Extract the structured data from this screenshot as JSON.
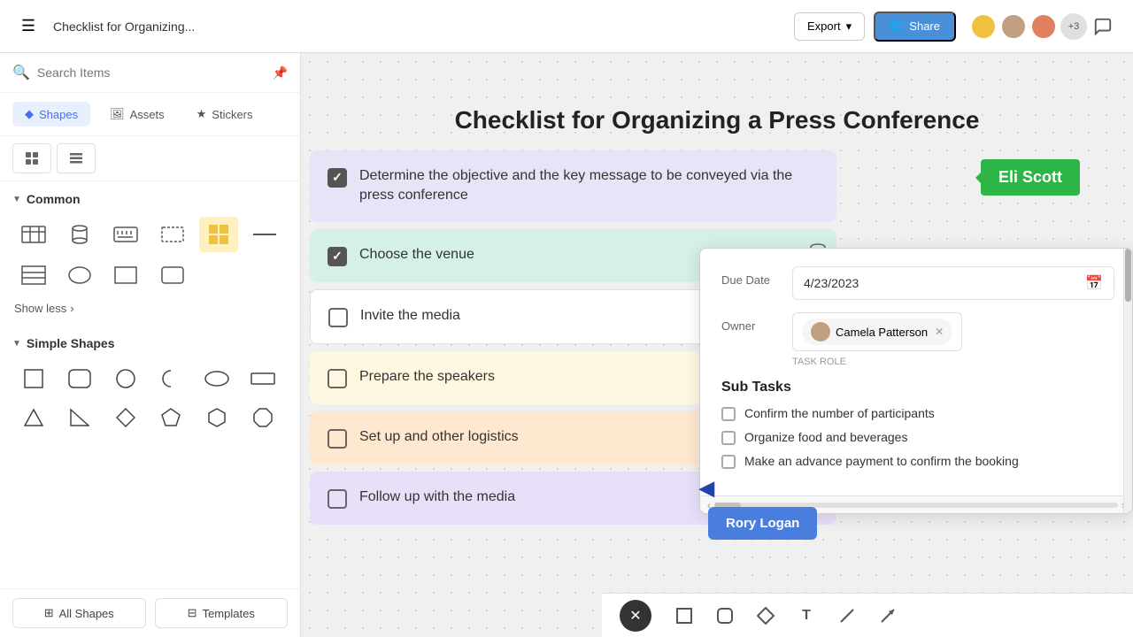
{
  "header": {
    "menu_icon": "☰",
    "title": "Checklist for Organizing...",
    "export_label": "Export",
    "share_label": "Share",
    "avatar_count": "+3",
    "comment_icon": "💬"
  },
  "sidebar": {
    "search_placeholder": "Search Items",
    "tabs": [
      {
        "id": "shapes",
        "label": "Shapes",
        "icon": "◆",
        "active": true
      },
      {
        "id": "assets",
        "label": "Assets",
        "icon": "🖼",
        "active": false
      },
      {
        "id": "stickers",
        "label": "Stickers",
        "icon": "★",
        "active": false
      }
    ],
    "common_section": {
      "title": "Common",
      "expanded": true
    },
    "simple_shapes_section": {
      "title": "Simple Shapes",
      "expanded": true
    },
    "show_less_label": "Show less",
    "bottom_buttons": [
      {
        "id": "all-shapes",
        "label": "All Shapes",
        "icon": "⊞"
      },
      {
        "id": "templates",
        "label": "Templates",
        "icon": "⊟"
      }
    ]
  },
  "canvas": {
    "title": "Checklist for Organizing a Press Conference",
    "checklist_items": [
      {
        "id": 1,
        "text": "Determine the objective and the key message to be conveyed via the press conference",
        "checked": true,
        "color_class": "ci-purple"
      },
      {
        "id": 2,
        "text": "Choose the venue",
        "checked": true,
        "color_class": "ci-teal"
      },
      {
        "id": 3,
        "text": "Invite the media",
        "checked": false,
        "color_class": "ci-white"
      },
      {
        "id": 4,
        "text": "Prepare the speakers",
        "checked": false,
        "color_class": "ci-yellow"
      },
      {
        "id": 5,
        "text": "Set up and other logistics",
        "checked": false,
        "color_class": "ci-orange"
      },
      {
        "id": 6,
        "text": "Follow up with the media",
        "checked": false,
        "color_class": "ci-lavender"
      }
    ]
  },
  "detail_panel": {
    "due_date_label": "Due Date",
    "due_date_value": "4/23/2023",
    "owner_label": "Owner",
    "task_role_label": "TASK ROLE",
    "owner_name": "Camela Patterson",
    "subtasks_title": "Sub Tasks",
    "subtasks": [
      {
        "id": 1,
        "text": "Confirm the number of participants",
        "checked": false
      },
      {
        "id": 2,
        "text": "Organize food and beverages",
        "checked": false
      },
      {
        "id": 3,
        "text": "Make an advance payment to confirm the booking",
        "checked": false
      }
    ]
  },
  "badges": {
    "eli": "Eli Scott",
    "rory": "Rory Logan"
  },
  "bottom_toolbar": {
    "tools": [
      {
        "id": "close",
        "icon": "✕",
        "type": "close"
      },
      {
        "id": "rect",
        "icon": "□"
      },
      {
        "id": "rounded-rect",
        "icon": "▭"
      },
      {
        "id": "diamond",
        "icon": "◇"
      },
      {
        "id": "text",
        "icon": "T"
      },
      {
        "id": "line",
        "icon": "╱"
      },
      {
        "id": "arrow",
        "icon": "➤"
      }
    ]
  }
}
